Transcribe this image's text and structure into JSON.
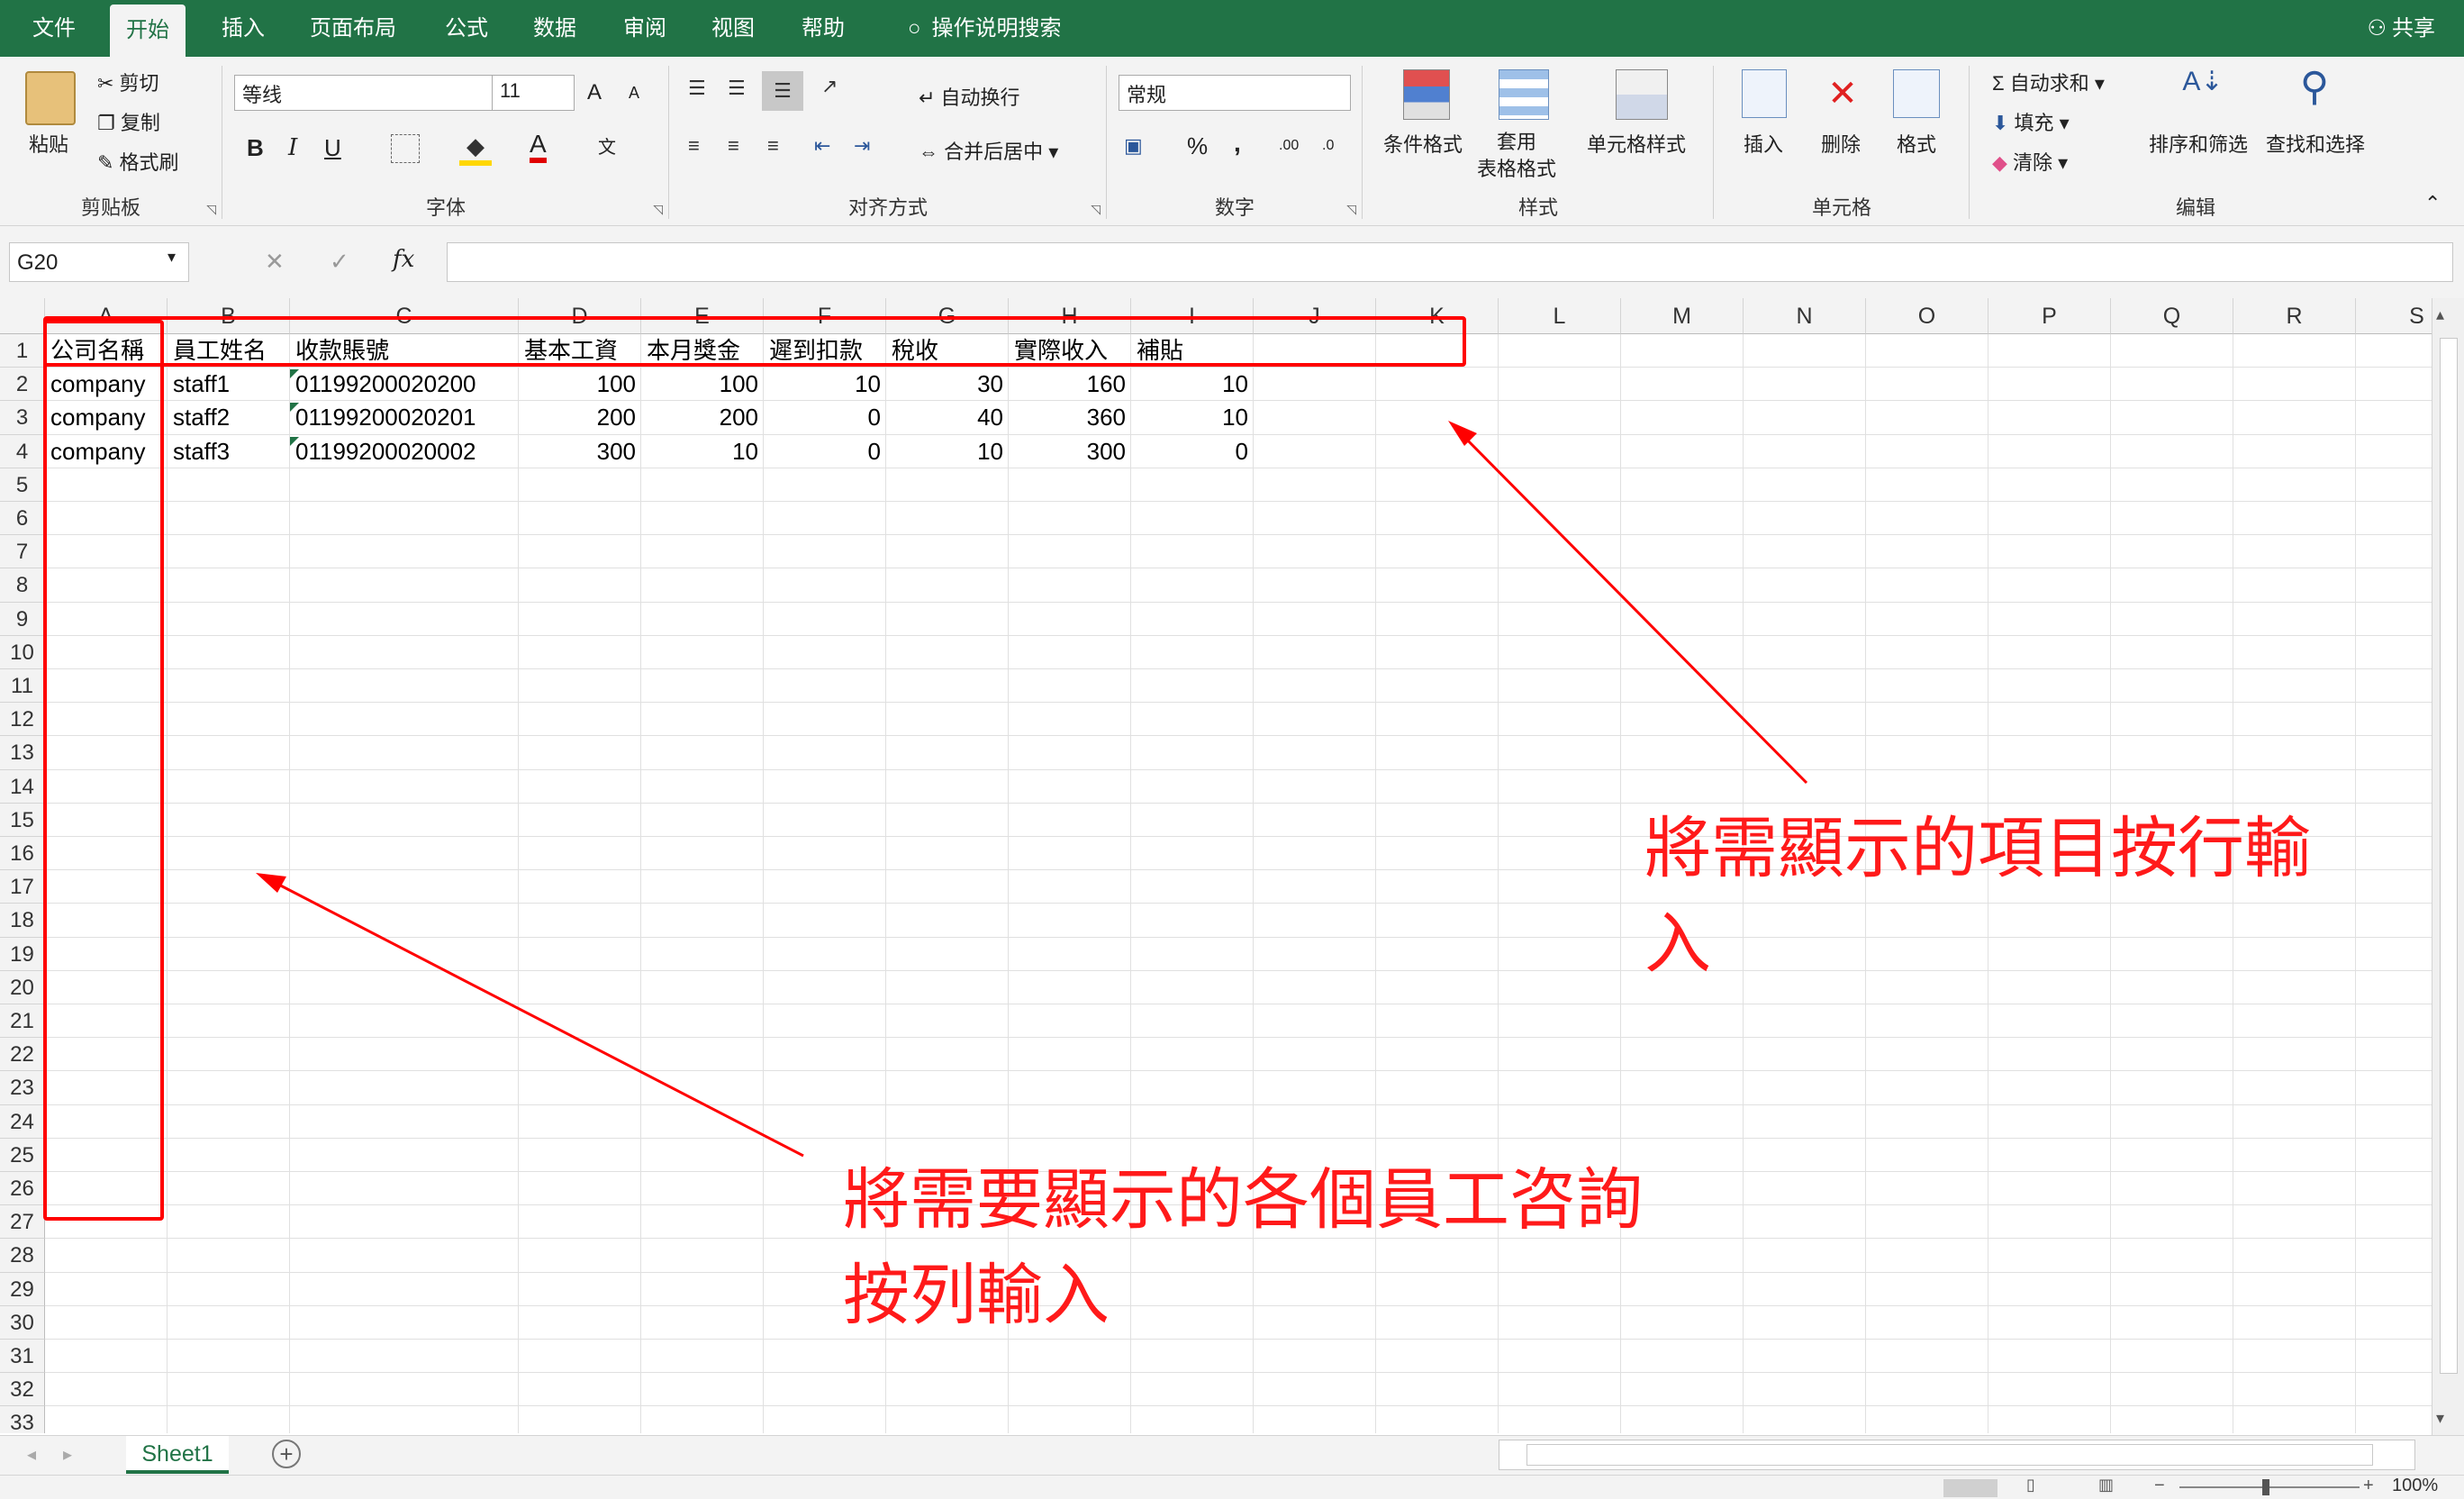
{
  "menu": {
    "tabs": [
      "文件",
      "开始",
      "插入",
      "页面布局",
      "公式",
      "数据",
      "审阅",
      "视图",
      "帮助"
    ],
    "tell_me": "操作说明搜索",
    "share": "共享"
  },
  "ribbon": {
    "clipboard": {
      "paste": "粘贴",
      "cut": "剪切",
      "copy": "复制",
      "format_painter": "格式刷",
      "label": "剪贴板"
    },
    "font": {
      "name": "等线",
      "size": "11",
      "bold": "B",
      "italic": "I",
      "underline": "U",
      "label": "字体",
      "grow": "A",
      "shrink": "A",
      "font_color_glyph": "A",
      "phonetic": "文"
    },
    "alignment": {
      "wrap": "自动换行",
      "merge": "合并后居中",
      "label": "对齐方式"
    },
    "number": {
      "format": "常规",
      "percent": "%",
      "comma": ",",
      "inc_decimal": ".00",
      "dec_decimal": ".0",
      "label": "数字"
    },
    "styles": {
      "conditional": "条件格式",
      "table": "套用\n表格格式",
      "cell_styles": "单元格样式",
      "label": "样式"
    },
    "cells": {
      "insert": "插入",
      "delete": "删除",
      "format": "格式",
      "label": "单元格"
    },
    "editing": {
      "autosum": "自动求和",
      "fill": "填充",
      "clear": "清除",
      "sort": "排序和筛选",
      "find": "查找和选择",
      "label": "编辑",
      "sigma": "Σ"
    }
  },
  "formula_bar": {
    "name_box": "G20",
    "fx": "fx",
    "cancel": "✕",
    "enter": "✓",
    "value": ""
  },
  "sheet": {
    "columns": [
      "A",
      "B",
      "C",
      "D",
      "E",
      "F",
      "G",
      "H",
      "I",
      "J",
      "K",
      "L",
      "M",
      "N",
      "O",
      "P",
      "Q",
      "R",
      "S"
    ],
    "row_numbers": [
      "1",
      "2",
      "3",
      "4",
      "5",
      "6",
      "7",
      "8",
      "9",
      "10",
      "11",
      "12",
      "13",
      "14",
      "15",
      "16",
      "17",
      "18",
      "19",
      "20",
      "21",
      "22",
      "23",
      "24",
      "25",
      "26",
      "27",
      "28",
      "29",
      "30",
      "31",
      "32",
      "33"
    ],
    "header": [
      "公司名稱",
      "員工姓名",
      "收款賬號",
      "基本工資",
      "本月獎金",
      "遲到扣款",
      "稅收",
      "實際收入",
      "補貼"
    ],
    "rows": [
      [
        "company",
        "staff1",
        "01199200020200",
        "100",
        "100",
        "10",
        "30",
        "160",
        "10"
      ],
      [
        "company",
        "staff2",
        "01199200020201",
        "200",
        "200",
        "0",
        "40",
        "360",
        "10"
      ],
      [
        "company",
        "staff3",
        "01199200020002",
        "300",
        "10",
        "0",
        "10",
        "300",
        "0"
      ]
    ]
  },
  "annotations": {
    "right_line1": "將需顯示的項目按行輸",
    "right_line2": "入",
    "bottom_line1": "將需要顯示的各個員工咨詢",
    "bottom_line2": "按列輸入",
    "color": "#ff0000"
  },
  "tabs": {
    "sheet1": "Sheet1",
    "add": "+"
  },
  "status": {
    "zoom": "100%"
  },
  "colors": {
    "excel_green": "#217346",
    "ribbon_bg": "#f3f3f3"
  }
}
